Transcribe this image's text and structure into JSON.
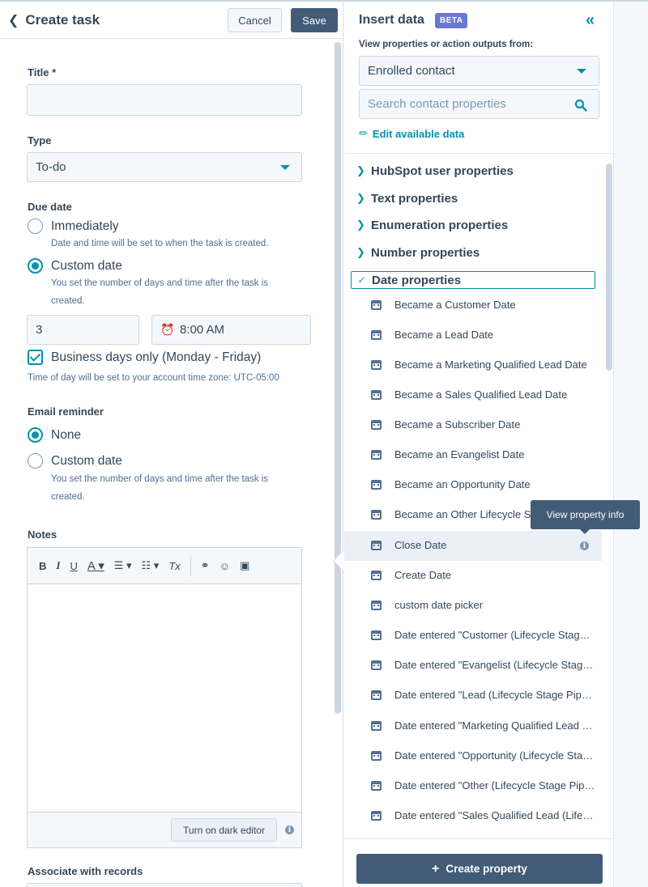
{
  "header": {
    "back_label": "Create task",
    "cancel_label": "Cancel",
    "save_label": "Save"
  },
  "form": {
    "title_label": "Title *",
    "title_value": "",
    "type_label": "Type",
    "type_value": "To-do",
    "due_label": "Due date",
    "due_options": [
      {
        "label": "Immediately",
        "help": "Date and time will be set to when the task is created.",
        "selected": false
      },
      {
        "label": "Custom date",
        "help": "You set the number of days and time after the task is created.",
        "selected": true
      }
    ],
    "days_value": "3",
    "time_value": "8:00 AM",
    "business_days_label": "Business days only (Monday - Friday)",
    "business_days_checked": true,
    "timezone_note": "Time of day will be set to your account time zone: UTC-05:00",
    "email_label": "Email reminder",
    "email_options": [
      {
        "label": "None",
        "selected": true
      },
      {
        "label": "Custom date",
        "help": "You set the number of days and time after the task is created.",
        "selected": false
      }
    ],
    "notes_label": "Notes",
    "dark_editor_label": "Turn on dark editor",
    "associate_label": "Associate with records"
  },
  "insert": {
    "title": "Insert data",
    "badge": "BETA",
    "subtitle": "View properties or action outputs from:",
    "source_value": "Enrolled contact",
    "search_placeholder": "Search contact properties",
    "edit_link": "Edit available data",
    "categories": [
      "HubSpot user properties",
      "Text properties",
      "Enumeration properties",
      "Number properties",
      "Date properties"
    ],
    "date_items": [
      "Became a Customer Date",
      "Became a Lead Date",
      "Became a Marketing Qualified Lead Date",
      "Became a Sales Qualified Lead Date",
      "Became a Subscriber Date",
      "Became an Evangelist Date",
      "Became an Opportunity Date",
      "Became an Other Lifecycle Stage Date",
      "Close Date",
      "Create Date",
      "custom date picker",
      "Date entered \"Customer (Lifecycle Stage Pipeline)\"",
      "Date entered \"Evangelist (Lifecycle Stage Pipeline)\"",
      "Date entered \"Lead (Lifecycle Stage Pipeline)\"",
      "Date entered \"Marketing Qualified Lead (Lifecycle Stage Pipeline)\"",
      "Date entered \"Opportunity (Lifecycle Stage Pipeline)\"",
      "Date entered \"Other (Lifecycle Stage Pipeline)\"",
      "Date entered \"Sales Qualified Lead (Lifecycle Stage Pipeline)\""
    ],
    "tooltip": "View property info",
    "create_label": "Create property"
  },
  "colors": {
    "accent": "#0091ae",
    "primary_button": "#425b76",
    "beta": "#6a78d1"
  }
}
